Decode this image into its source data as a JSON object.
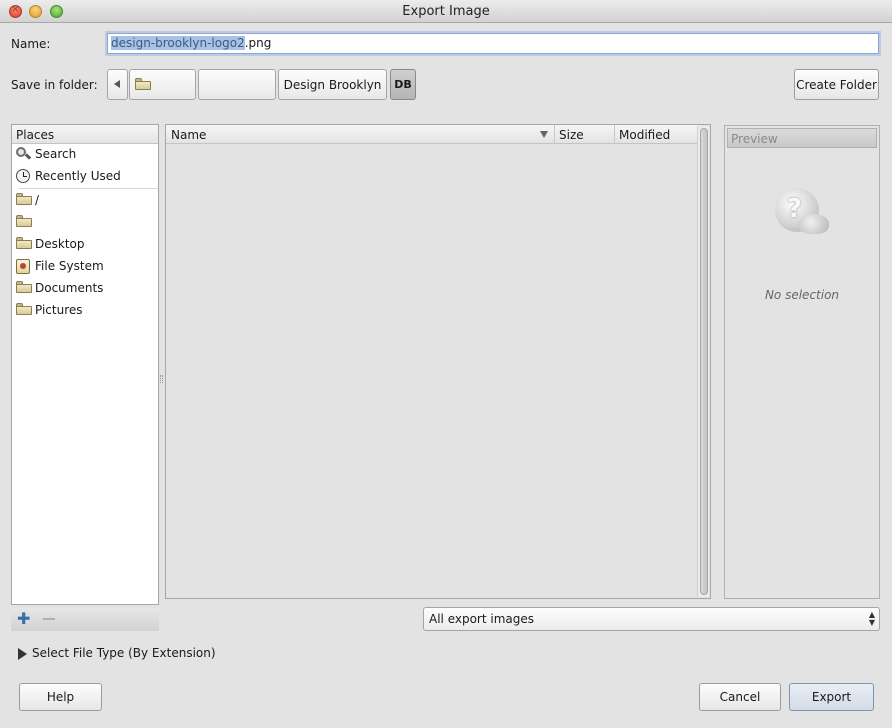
{
  "window": {
    "title": "Export Image"
  },
  "name_row": {
    "label": "Name:",
    "value_selected": "design-brooklyn-logo2",
    "value_rest": ".png"
  },
  "folder_row": {
    "label": "Save in folder:",
    "breadcrumbs": [
      "",
      "",
      "Design Brooklyn",
      "DB"
    ],
    "create_folder": "Create Folder"
  },
  "places": {
    "header": "Places",
    "items": [
      {
        "label": "Search",
        "icon": "search-icon"
      },
      {
        "label": "Recently Used",
        "icon": "clock-icon"
      },
      {
        "label": "/",
        "icon": "folder-icon"
      },
      {
        "label": "",
        "icon": "folder-icon"
      },
      {
        "label": "Desktop",
        "icon": "folder-icon"
      },
      {
        "label": "File System",
        "icon": "filesystem-icon"
      },
      {
        "label": "Documents",
        "icon": "folder-icon"
      },
      {
        "label": "Pictures",
        "icon": "folder-icon"
      }
    ]
  },
  "file_list": {
    "columns": [
      "Name",
      "Size",
      "Modified"
    ]
  },
  "preview": {
    "header": "Preview",
    "empty_text": "No selection"
  },
  "filter": {
    "selected": "All export images"
  },
  "file_type": {
    "label": "Select File Type (By Extension)"
  },
  "buttons": {
    "help": "Help",
    "cancel": "Cancel",
    "export": "Export"
  }
}
